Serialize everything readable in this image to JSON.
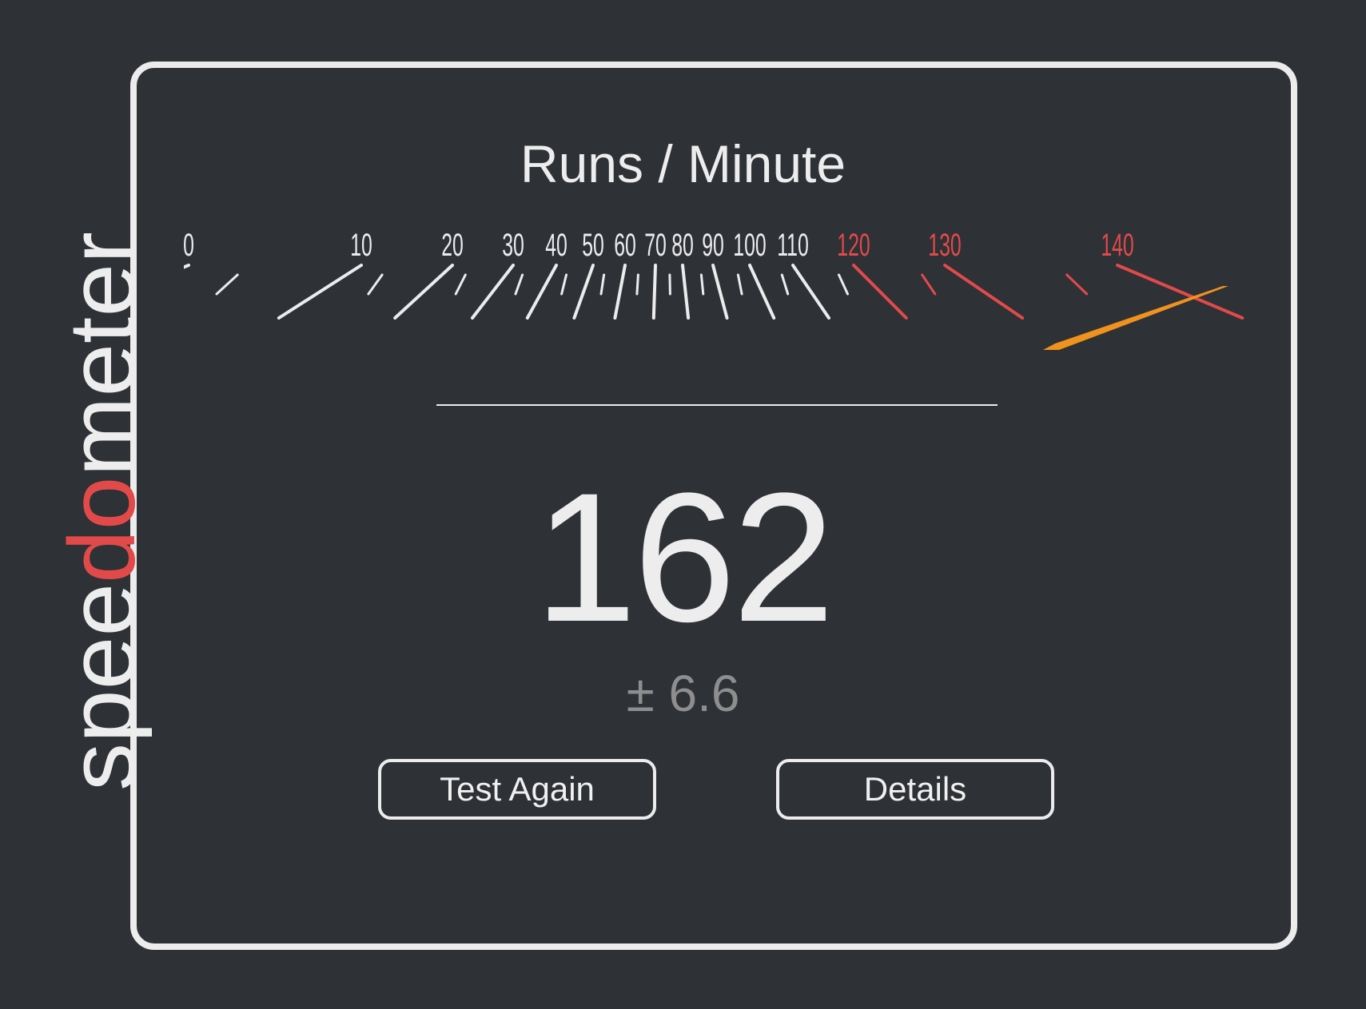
{
  "logo": {
    "prefix": "spee",
    "highlight": "do",
    "suffix": "meter",
    "text_color": "#ededed",
    "highlight_color": "#e24a4a"
  },
  "result": {
    "title": "Runs / Minute",
    "score": "162",
    "uncertainty": "± 6.6"
  },
  "gauge": {
    "tick_labels": [
      "0",
      "10",
      "20",
      "30",
      "40",
      "50",
      "60",
      "70",
      "80",
      "90",
      "100",
      "110",
      "120",
      "130",
      "140"
    ],
    "danger_from": "120",
    "normal_color": "#ececec",
    "danger_color": "#e24a4a",
    "needle_color": "#f0921e"
  },
  "actions": {
    "test_again_label": "Test Again",
    "details_label": "Details"
  }
}
